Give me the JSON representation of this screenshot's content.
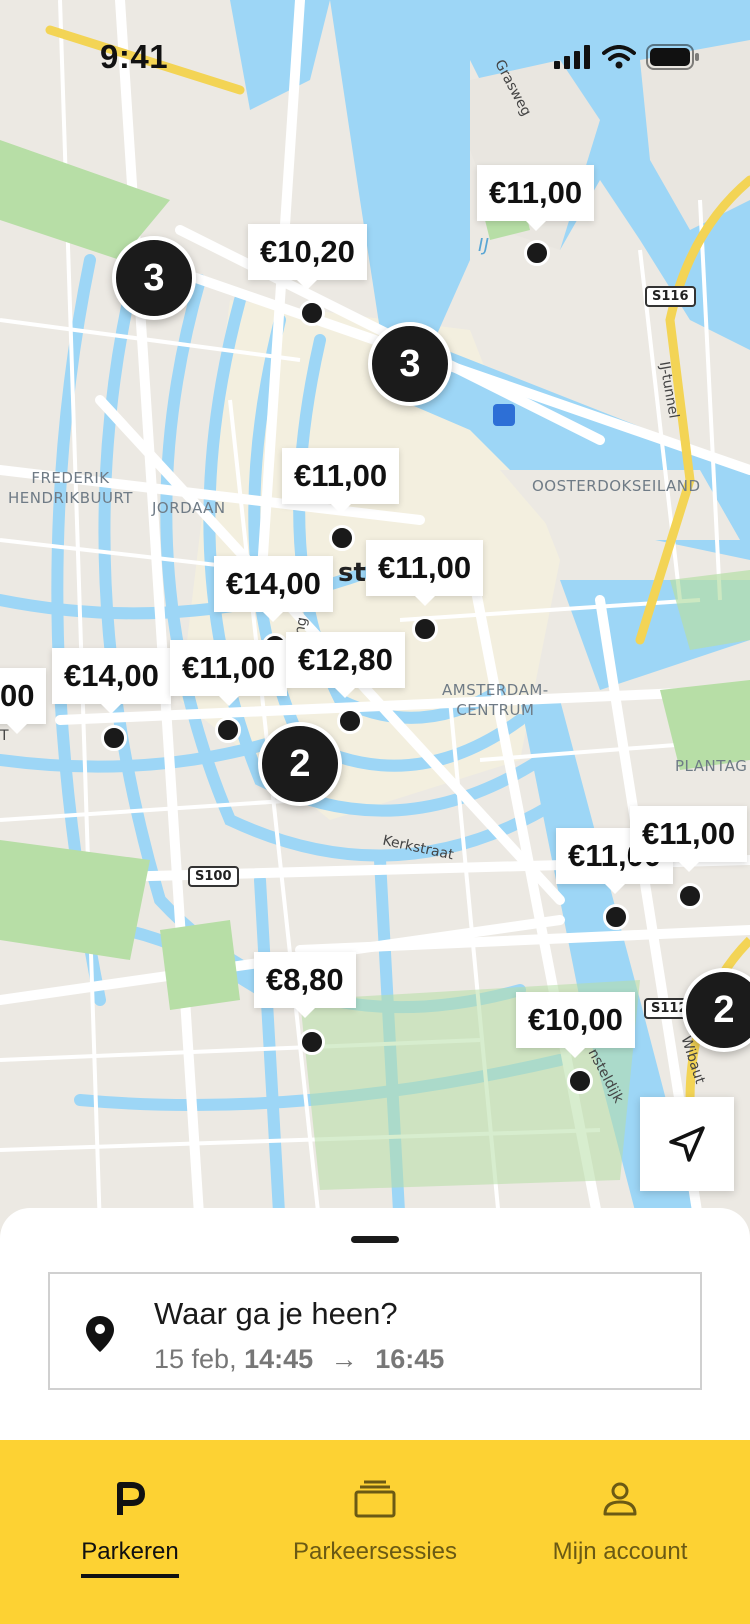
{
  "status_bar": {
    "time": "9:41"
  },
  "map": {
    "area_labels": [
      {
        "id": "frederik",
        "text": "FREDERIK\nHENDRIKBUURT"
      },
      {
        "id": "jordaan",
        "text": "JORDAAN"
      },
      {
        "id": "oosterdok",
        "text": "OOSTERDOKSEILAND"
      },
      {
        "id": "centrum",
        "text": "AMSTERDAM-\nCENTRUM"
      },
      {
        "id": "plantag",
        "text": "PLANTAG"
      },
      {
        "id": "ij",
        "text": "IJ"
      }
    ],
    "road_labels": [
      {
        "id": "grasweg",
        "text": "Grasweg"
      },
      {
        "id": "ijtunnel",
        "text": "IJ-tunnel"
      },
      {
        "id": "kerkstraat",
        "text": "Kerkstraat"
      },
      {
        "id": "wibaut",
        "text": "Wibaut"
      },
      {
        "id": "nsteldijk",
        "text": "nsteldijk"
      },
      {
        "id": "st",
        "text": "st"
      },
      {
        "id": "ing",
        "text": "ing"
      },
      {
        "id": "t",
        "text": "T"
      }
    ],
    "road_shields": [
      {
        "id": "s116",
        "text": "S116"
      },
      {
        "id": "s100",
        "text": "S100"
      },
      {
        "id": "s112",
        "text": "S112"
      }
    ],
    "price_markers": [
      "€11,00",
      "€10,20",
      "€11,00",
      "€11,00",
      "€14,00",
      "€14,00",
      "€11,00",
      "€12,80",
      "€11,00",
      "€11,00",
      "€8,80",
      "€10,00",
      "00"
    ],
    "clusters": [
      "3",
      "3",
      "2",
      "2"
    ]
  },
  "search": {
    "title": "Waar ga je heen?",
    "date": "15 feb,",
    "start": "14:45",
    "arrow": "→",
    "end": "16:45"
  },
  "tabs": [
    {
      "label": "Parkeren",
      "icon": "parking-icon",
      "active": true
    },
    {
      "label": "Parkeersessies",
      "icon": "sessions-icon",
      "active": false
    },
    {
      "label": "Mijn account",
      "icon": "account-icon",
      "active": false
    }
  ],
  "colors": {
    "accent_yellow": "#fdd233",
    "water": "#9dd6f6",
    "park": "#b7dea6"
  }
}
